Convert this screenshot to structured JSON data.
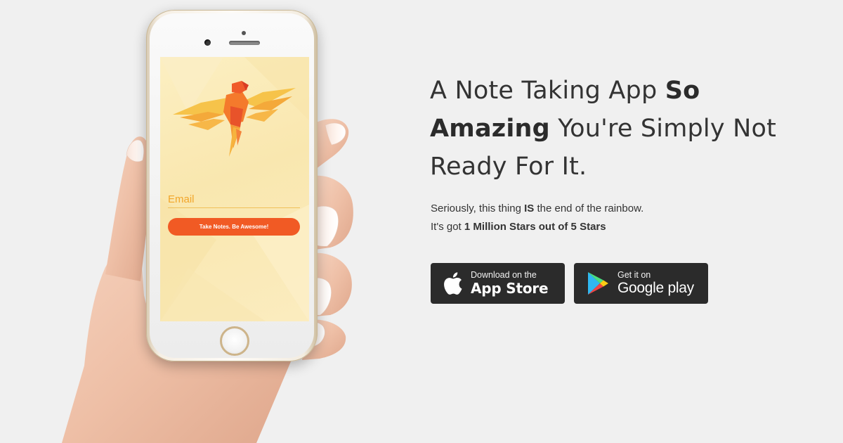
{
  "phone_app": {
    "email_placeholder": "Email",
    "cta_label": "Take Notes. Be Awesome!",
    "colors": {
      "screen_bg": "#f9e7af",
      "cta": "#f15a24",
      "field_text": "#f2a020"
    }
  },
  "hero": {
    "headline_part1": "A Note Taking App ",
    "headline_strong1": "So Amazing",
    "headline_part2": " You're Simply Not Ready For It.",
    "line1_part1": "Seriously, this thing ",
    "line1_strong": "IS",
    "line1_part2": " the end of the rainbow.",
    "line2_part1": "It's got ",
    "line2_strong": "1 Million Stars out of 5 Stars"
  },
  "badges": {
    "app_store": {
      "small": "Download on the",
      "big": "App Store",
      "icon": "apple-icon"
    },
    "google_play": {
      "small": "Get it on",
      "big": "Google play",
      "icon": "google-play-icon"
    }
  },
  "colors": {
    "page_bg": "#f0f0f0",
    "text": "#333333",
    "badge_bg": "#2b2b2b"
  }
}
